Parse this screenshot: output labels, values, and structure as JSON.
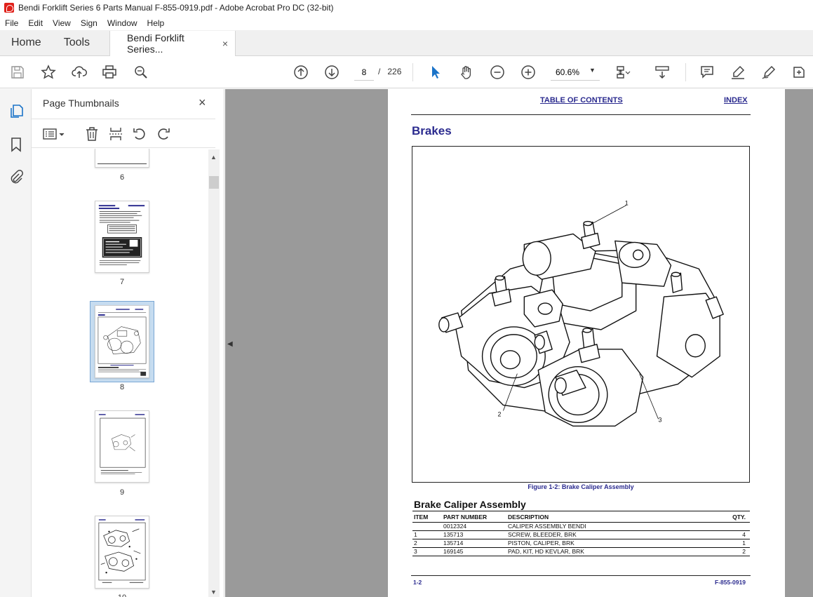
{
  "window": {
    "title": "Bendi Forklift Series 6 Parts Manual  F-855-0919.pdf - Adobe Acrobat Pro DC (32-bit)"
  },
  "menu": {
    "items": [
      "File",
      "Edit",
      "View",
      "Sign",
      "Window",
      "Help"
    ]
  },
  "tabs": {
    "home": "Home",
    "tools": "Tools",
    "document": "Bendi Forklift Series...",
    "close": "×"
  },
  "toolbar": {
    "current_page": "8",
    "page_separator": "/",
    "page_count": "226",
    "zoom": "60.6%"
  },
  "panel": {
    "title": "Page Thumbnails",
    "close": "×",
    "thumbnails": [
      {
        "label": "6"
      },
      {
        "label": "7"
      },
      {
        "label": "8"
      },
      {
        "label": "9"
      },
      {
        "label": "10"
      }
    ],
    "selected_page": "8"
  },
  "pdf": {
    "toc_link": "TABLE OF CONTENTS",
    "index_link": "INDEX",
    "heading": "Brakes",
    "callouts": [
      "1",
      "2",
      "3"
    ],
    "figure_caption": "Figure 1-2:  Brake Caliper Assembly",
    "section_title": "Brake Caliper Assembly",
    "table": {
      "headers": [
        "ITEM",
        "PART NUMBER",
        "DESCRIPTION",
        "QTY."
      ],
      "rows": [
        [
          "",
          "0012324",
          "CALIPER ASSEMBLY BENDI",
          ""
        ],
        [
          "1",
          "135713",
          "SCREW, BLEEDER, BRK",
          "4"
        ],
        [
          "2",
          "135714",
          "PISTON, CALIPER, BRK",
          "1"
        ],
        [
          "3",
          "169145",
          "PAD, KIT, HD KEVLAR, BRK",
          "2"
        ]
      ]
    },
    "footer_left": "1-2",
    "footer_right": "F-855-0919"
  },
  "colors": {
    "link_blue": "#2b2b8f",
    "viewer_gray": "#9a9a9a",
    "selection": "#c6dcf0"
  }
}
